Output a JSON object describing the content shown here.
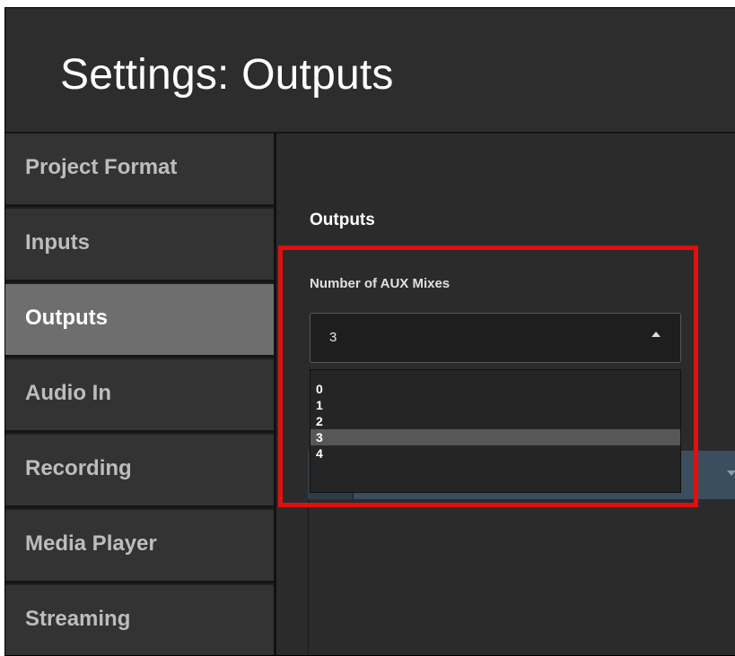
{
  "window": {
    "title": "Settings: Outputs"
  },
  "sidebar": {
    "items": [
      {
        "label": "Project Format",
        "active": false
      },
      {
        "label": "Inputs",
        "active": false
      },
      {
        "label": "Outputs",
        "active": true
      },
      {
        "label": "Audio In",
        "active": false
      },
      {
        "label": "Recording",
        "active": false
      },
      {
        "label": "Media Player",
        "active": false
      },
      {
        "label": "Streaming",
        "active": false
      }
    ]
  },
  "main": {
    "section_heading": "Outputs",
    "aux_mixes": {
      "label": "Number of AUX Mixes",
      "selected_value": "3",
      "options": [
        "0",
        "1",
        "2",
        "3",
        "4"
      ]
    }
  },
  "colors": {
    "highlight": "#e01010",
    "active_nav": "#6e6e6e",
    "selected_option": "#575757"
  }
}
